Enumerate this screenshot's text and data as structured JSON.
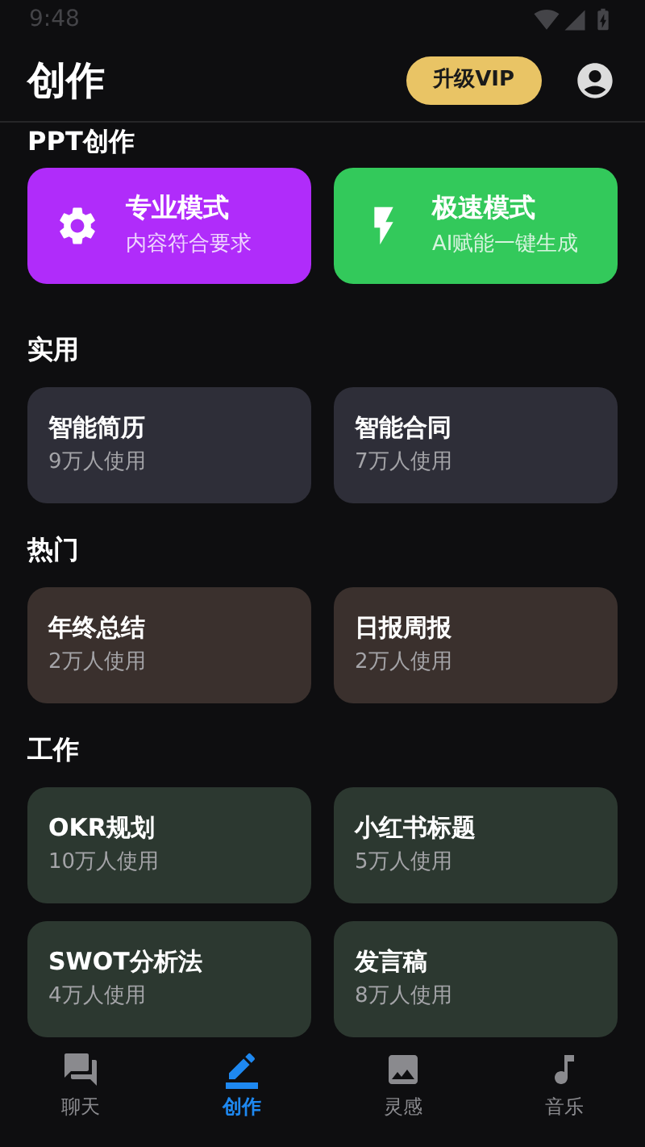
{
  "status_bar": {
    "time": "9:48"
  },
  "header": {
    "title": "创作",
    "vip_button": "升级VIP"
  },
  "ppt_section": {
    "title": "PPT创作",
    "modes": [
      {
        "kind": "gear",
        "title": "专业模式",
        "subtitle": "内容符合要求",
        "color": "#b02cfa"
      },
      {
        "kind": "bolt",
        "title": "极速模式",
        "subtitle": "AI赋能一键生成",
        "color": "#33c95b"
      }
    ]
  },
  "sections": [
    {
      "title": "实用",
      "color": "#2e2e38",
      "items": [
        {
          "title": "智能简历",
          "subtitle": "9万人使用"
        },
        {
          "title": "智能合同",
          "subtitle": "7万人使用"
        }
      ]
    },
    {
      "title": "热门",
      "color": "#3a302d",
      "items": [
        {
          "title": "年终总结",
          "subtitle": "2万人使用"
        },
        {
          "title": "日报周报",
          "subtitle": "2万人使用"
        }
      ]
    },
    {
      "title": "工作",
      "color": "#2c3830",
      "items": [
        {
          "title": "OKR规划",
          "subtitle": "10万人使用"
        },
        {
          "title": "小红书标题",
          "subtitle": "5万人使用"
        },
        {
          "title": "SWOT分析法",
          "subtitle": "4万人使用"
        },
        {
          "title": "发言稿",
          "subtitle": "8万人使用"
        }
      ]
    }
  ],
  "bottom_nav": [
    {
      "kind": "chat",
      "label": "聊天",
      "selected": false
    },
    {
      "kind": "pen",
      "label": "创作",
      "selected": true
    },
    {
      "kind": "image",
      "label": "灵感",
      "selected": false
    },
    {
      "kind": "music",
      "label": "音乐",
      "selected": false
    }
  ]
}
